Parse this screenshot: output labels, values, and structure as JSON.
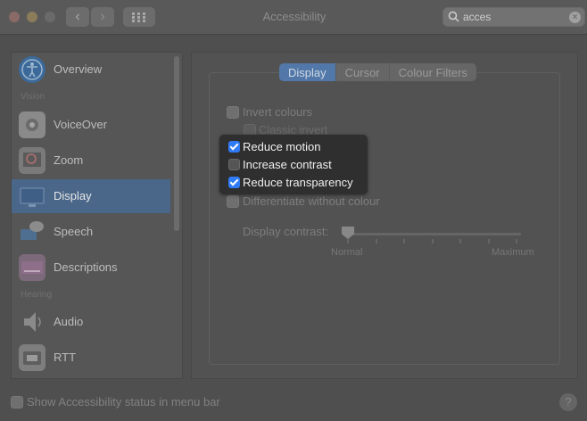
{
  "window": {
    "title": "Accessibility",
    "nav_back": "‹",
    "nav_forward": "›"
  },
  "search": {
    "value": "acces",
    "clear_glyph": "×"
  },
  "sidebar": {
    "items": [
      {
        "label": "Overview",
        "icon": "accessibility-icon"
      },
      {
        "label": "VoiceOver",
        "icon": "voiceover-icon"
      },
      {
        "label": "Zoom",
        "icon": "zoom-icon"
      },
      {
        "label": "Display",
        "icon": "display-icon",
        "selected": true
      },
      {
        "label": "Speech",
        "icon": "speech-icon"
      },
      {
        "label": "Descriptions",
        "icon": "descriptions-icon"
      },
      {
        "label": "Audio",
        "icon": "speaker-icon"
      },
      {
        "label": "RTT",
        "icon": "telephone-icon"
      }
    ],
    "sections": {
      "vision": "Vision",
      "hearing": "Hearing"
    }
  },
  "tabs": [
    {
      "label": "Display",
      "active": true
    },
    {
      "label": "Cursor",
      "active": false
    },
    {
      "label": "Colour Filters",
      "active": false
    }
  ],
  "options": {
    "invert_colours": "Invert colours",
    "classic_invert": "Classic invert",
    "reduce_motion": "Reduce motion",
    "increase_contrast": "Increase contrast",
    "reduce_transparency": "Reduce transparency",
    "differentiate": "Differentiate without colour"
  },
  "option_states": {
    "reduce_motion": true,
    "increase_contrast": false,
    "reduce_transparency": true
  },
  "contrast": {
    "label": "Display contrast:",
    "min_label": "Normal",
    "max_label": "Maximum",
    "value": 0
  },
  "footer": {
    "show_status_label": "Show Accessibility status in menu bar",
    "help_label": "?"
  },
  "colors": {
    "accent": "#2f7bf6",
    "selected_row": "#4a678a"
  }
}
